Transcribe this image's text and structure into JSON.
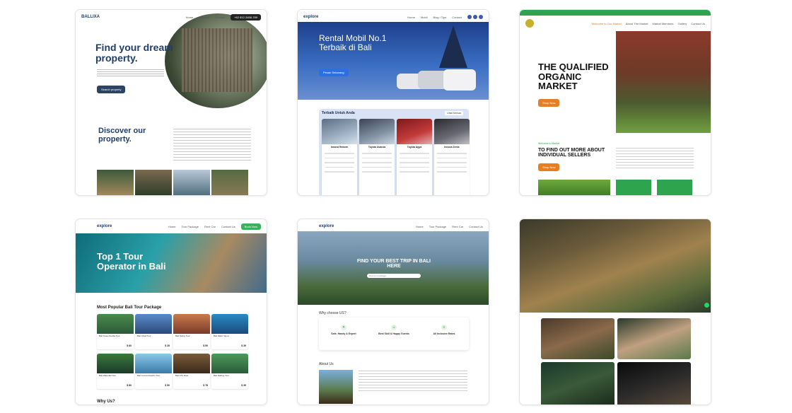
{
  "cards": {
    "ballixa": {
      "logo": "BALLIXA",
      "nav": [
        "Home",
        "Property",
        "Contact"
      ],
      "cta": "+62 812-3456-789",
      "hero_title": "Find your dream property.",
      "hero_button": "Search property",
      "section_title": "Discover our property."
    },
    "rental": {
      "logo": "explore",
      "nav": [
        "Home",
        "Mobil",
        "Blog / Tips",
        "Contact"
      ],
      "hero_title": "Rental Mobil No.1 Terbaik di Bali",
      "hero_button": "Pesan Sekarang",
      "section_title": "Terbaik Untuk Anda",
      "section_button": "Lihat Semua",
      "cars": [
        "Innova Reborn",
        "Toyota Avanza",
        "Toyota Agya",
        "Innova Zenix"
      ]
    },
    "organic": {
      "nav": [
        "Welcome to Our Market",
        "About The Market",
        "Market Members",
        "Gallery",
        "Contact Us"
      ],
      "hero_title": "THE QUALIFIED ORGANIC MARKET",
      "hero_button": "Shop Now",
      "section_eyebrow": "Welcome to Market",
      "section_title": "TO FIND OUT MORE ABOUT INDIVIDUAL SELLERS",
      "section_button": "Shop Now"
    },
    "explore_tour": {
      "logo": "explore",
      "nav": [
        "Home",
        "Tour Package",
        "Rent Car",
        "Contact Us"
      ],
      "nav_button": "Book Now",
      "hero_title": "Top 1 Tour Operator in Bali",
      "section_title": "Most Popular Bali Tour Package",
      "packages": [
        {
          "title": "Bali Nusa Penida Tour",
          "price": "$ 60"
        },
        {
          "title": "Bali Ubud Tour",
          "price": "$ 28"
        },
        {
          "title": "Bali Swing Tour",
          "price": "$ 50"
        },
        {
          "title": "Bali Water Sport",
          "price": "$ 39"
        },
        {
          "title": "Bali Waterfall Tour",
          "price": "$ 80"
        },
        {
          "title": "Bali Lovina Dolphin Tour",
          "price": "$ 50"
        },
        {
          "title": "Bali ATV Ride",
          "price": "$ 78"
        },
        {
          "title": "Bali Rafting Tour",
          "price": "$ 39"
        }
      ],
      "footer_title": "Why Us?"
    },
    "explore_trip": {
      "logo": "explore",
      "nav": [
        "Home",
        "Tour Package",
        "Rent Car",
        "Contact Us"
      ],
      "hero_title": "FIND YOUR BEST TRIP IN BALI HERE",
      "search_placeholder": "Find tour package",
      "why_title": "Why choose US?",
      "features": [
        "Safe, Handy & Expert",
        "Best Skill & Happy Guests",
        "All Inclusive Rates"
      ],
      "about_title": "About Us"
    }
  }
}
